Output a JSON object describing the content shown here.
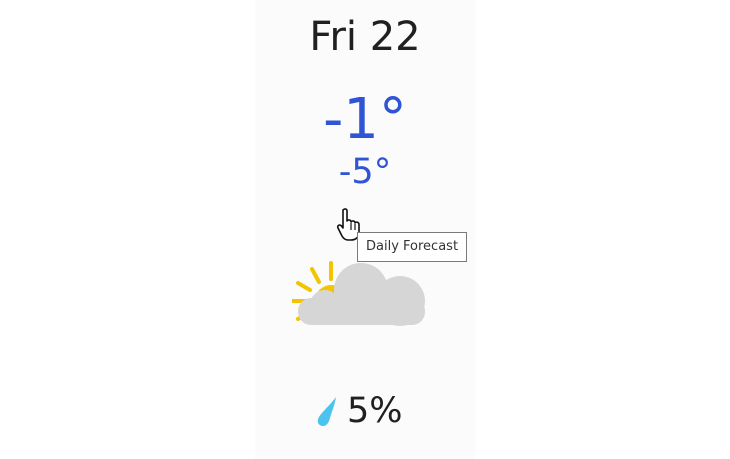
{
  "forecast": {
    "day_label": "Fri 22",
    "temp_high": "-1°",
    "temp_low": "-5°",
    "precipitation": "5%"
  },
  "icons": {
    "weather": "partly-cloudy-icon",
    "precipitation": "raindrop-icon",
    "cursor": "hand-pointer-cursor-icon"
  },
  "tooltip": {
    "text": "Daily Forecast"
  },
  "colors": {
    "temperature": "#2f55d4",
    "sun": "#f2c500",
    "cloud": "#d6d6d6",
    "raindrop": "#4cc3ee",
    "text": "#202020"
  }
}
